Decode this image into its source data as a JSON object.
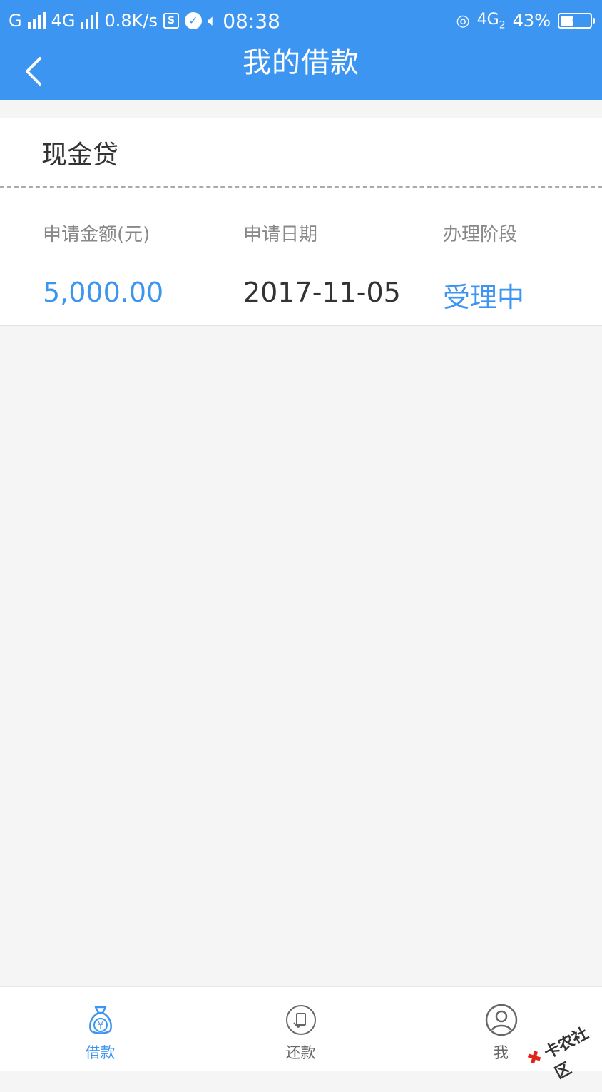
{
  "status_bar": {
    "carrier1": "G",
    "carrier2": "4G",
    "speed": "0.8K/s",
    "s_icon_text": "S",
    "time": "08:38",
    "network": "4G",
    "network_sub": "2",
    "battery": "43%",
    "battery_level": 0.43
  },
  "header": {
    "title": "我的借款"
  },
  "loan_card": {
    "product_name": "现金贷",
    "columns": [
      {
        "label": "申请金额(元)",
        "value": "5,000.00"
      },
      {
        "label": "申请日期",
        "value": "2017-11-05"
      },
      {
        "label": "办理阶段",
        "value": "受理中"
      }
    ]
  },
  "tabbar": {
    "tabs": [
      {
        "label": "借款",
        "icon": "money-bag-icon",
        "active": true
      },
      {
        "label": "还款",
        "icon": "repay-icon",
        "active": false
      },
      {
        "label": "我",
        "icon": "user-icon",
        "active": false
      }
    ]
  },
  "watermark": {
    "text": "卡农社区"
  },
  "colors": {
    "primary": "#3d95f2",
    "background": "#f5f5f5",
    "text_dark": "#333333",
    "text_muted": "#888888"
  }
}
